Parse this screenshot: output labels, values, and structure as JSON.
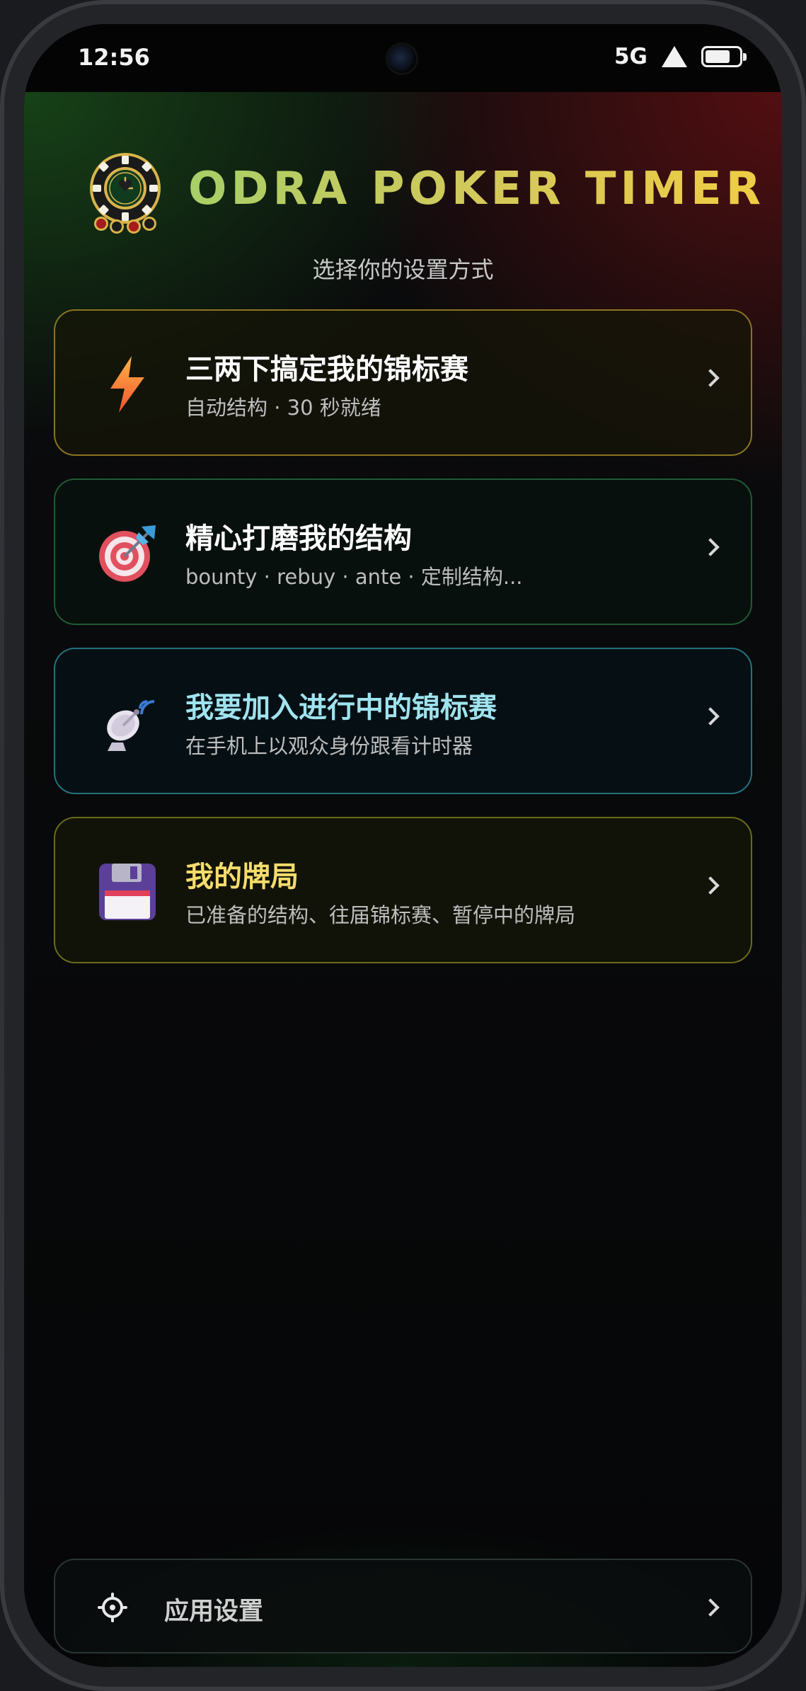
{
  "status_bar": {
    "time": "12:56",
    "network": "5G"
  },
  "header": {
    "title": "ODRA POKER TIMER",
    "subtitle": "选择你的设置方式"
  },
  "menu": [
    {
      "title": "三两下搞定我的锦标赛",
      "subtitle": "自动结构 · 30 秒就绪",
      "icon": "lightning-icon"
    },
    {
      "title": "精心打磨我的结构",
      "subtitle": "bounty · rebuy · ante · 定制结构...",
      "icon": "dart-target-icon"
    },
    {
      "title": "我要加入进行中的锦标赛",
      "subtitle": "在手机上以观众身份跟看计时器",
      "icon": "satellite-dish-icon"
    },
    {
      "title": "我的牌局",
      "subtitle": "已准备的结构、往届锦标赛、暂停中的牌局",
      "icon": "floppy-disk-icon"
    }
  ],
  "settings": {
    "label": "应用设置",
    "icon": "gear-icon"
  },
  "colors": {
    "title_gradient_start": "#a8cf68",
    "title_gradient_end": "#f0cc44",
    "join_title": "#9fe3ee",
    "games_title": "#f6dc6c"
  }
}
